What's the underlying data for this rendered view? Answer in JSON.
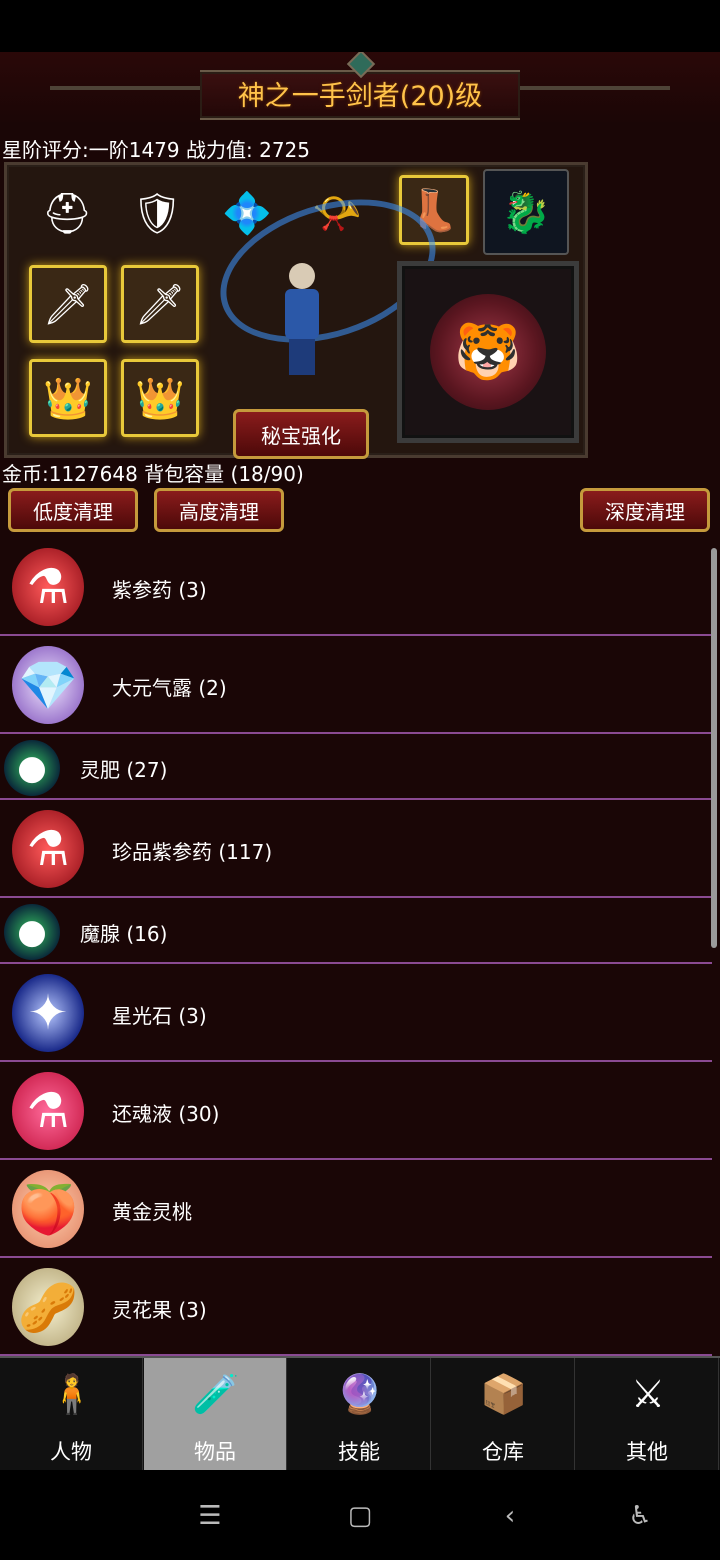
{
  "header": {
    "title": "神之一手剑者(20)级"
  },
  "stats": {
    "text": "星阶评分:一阶1479 战力值: 2725"
  },
  "equipment": {
    "slots": [
      {
        "icon": "helmet-icon",
        "glyph": "⛑"
      },
      {
        "icon": "armor-icon",
        "glyph": "🛡"
      },
      {
        "icon": "necklace-icon",
        "glyph": "💠"
      },
      {
        "icon": "horn-icon",
        "glyph": "📯"
      },
      {
        "icon": "boots-icon",
        "glyph": "👢"
      },
      {
        "icon": "dragon-mount-icon",
        "glyph": "🐉"
      },
      {
        "icon": "sword-icon",
        "glyph": "🗡"
      },
      {
        "icon": "sword-icon",
        "glyph": "🗡"
      },
      {
        "icon": "crown-icon",
        "glyph": "👑"
      },
      {
        "icon": "crown-icon",
        "glyph": "👑"
      }
    ],
    "pet_glyph": "🐯",
    "treasure_button": "秘宝强化"
  },
  "bag": {
    "text": "金币:1127648 背包容量 (18/90)"
  },
  "cleanup": {
    "low": "低度清理",
    "high": "高度清理",
    "deep": "深度清理"
  },
  "items": [
    {
      "name": "紫参药 (3)",
      "icon": "red-potion-icon",
      "glyph": "⚗",
      "color": "#c8182a"
    },
    {
      "name": "大元气露 (2)",
      "icon": "crystal-icon",
      "glyph": "💎",
      "color": "#b48ae0"
    },
    {
      "name": "灵肥 (27)",
      "icon": "orb-icon",
      "glyph": "●",
      "color": "#1e8a3a"
    },
    {
      "name": "珍品紫参药 (117)",
      "icon": "red-potion-icon",
      "glyph": "⚗",
      "color": "#c8182a"
    },
    {
      "name": "魔腺 (16)",
      "icon": "orb-icon",
      "glyph": "●",
      "color": "#1e8a3a"
    },
    {
      "name": "星光石 (3)",
      "icon": "star-stone-icon",
      "glyph": "✦",
      "color": "#3a4ab8"
    },
    {
      "name": "还魂液 (30)",
      "icon": "pink-potion-icon",
      "glyph": "⚗",
      "color": "#e8205a"
    },
    {
      "name": "黄金灵桃",
      "icon": "peach-icon",
      "glyph": "🍑",
      "color": "#f0a080"
    },
    {
      "name": "灵花果 (3)",
      "icon": "nut-icon",
      "glyph": "🥜",
      "color": "#d8d0a0"
    }
  ],
  "nav": [
    {
      "label": "人物",
      "icon": "character-icon",
      "glyph": "🧍"
    },
    {
      "label": "物品",
      "icon": "potion-bag-icon",
      "glyph": "🧪"
    },
    {
      "label": "技能",
      "icon": "skill-orb-icon",
      "glyph": "🔮"
    },
    {
      "label": "仓库",
      "icon": "storage-icon",
      "glyph": "📦"
    },
    {
      "label": "其他",
      "icon": "sword-shield-icon",
      "glyph": "⚔"
    }
  ],
  "system_nav": {
    "menu": "☰",
    "home": "▢",
    "back": "‹",
    "accessibility": "♿"
  }
}
